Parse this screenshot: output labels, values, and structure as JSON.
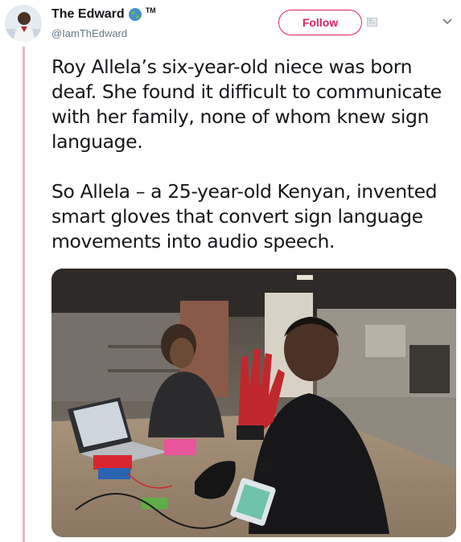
{
  "user": {
    "display_name": "The Edward",
    "tm": "TM",
    "handle": "@IamThEdward"
  },
  "follow_label": "Follow",
  "tweet": {
    "paragraphs": [
      "Roy Allela’s six-year-old niece was born deaf. She found it difficult to communicate with her family, none of whom knew sign language.",
      "So Allela – a 25-year-old Kenyan, invented smart gloves that convert sign language movements into audio speech."
    ]
  },
  "colors": {
    "accent": "#e0245e",
    "thread": "#e6b9c2",
    "text": "#14171a",
    "muted": "#657786"
  },
  "icons": {
    "globe": "globe-icon",
    "chevron": "chevron-down-icon",
    "small": "card-icon"
  }
}
